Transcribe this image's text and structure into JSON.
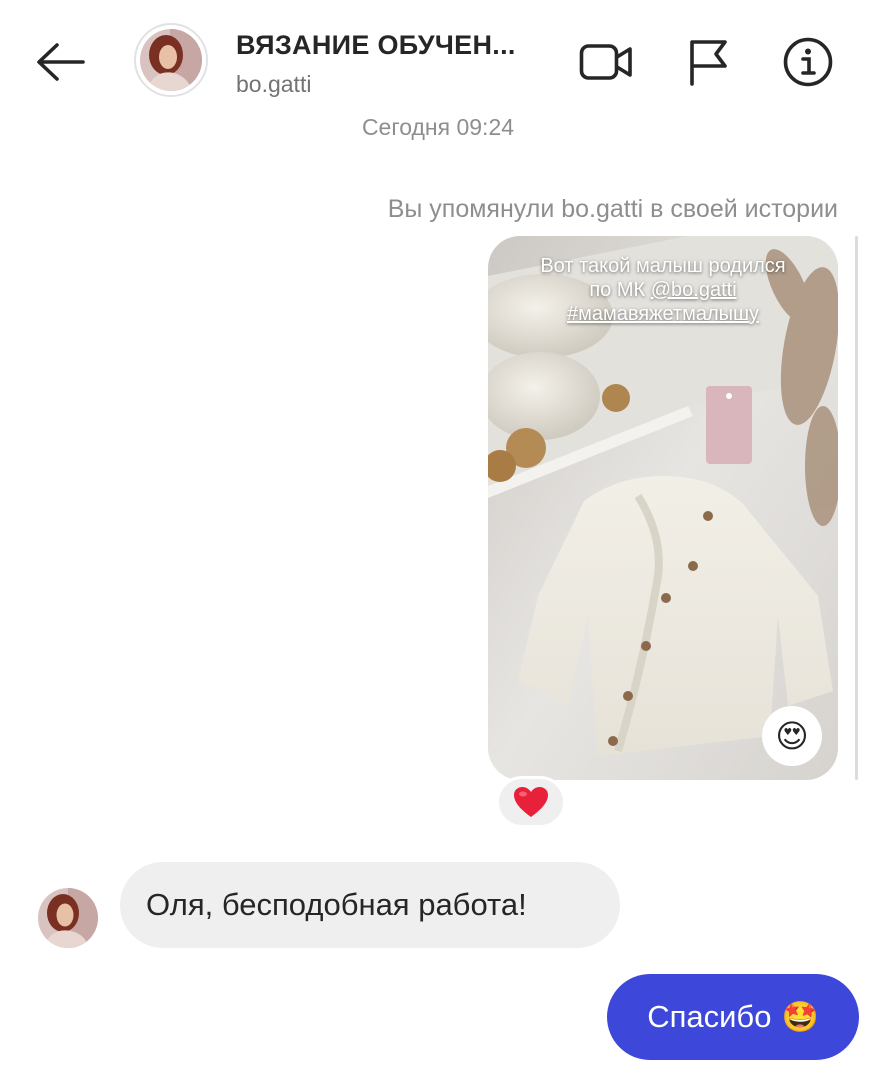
{
  "header": {
    "title": "ВЯЗАНИЕ ОБУЧЕН...",
    "username": "bo.gatti",
    "back_icon": "arrow-left-icon",
    "video_icon": "video-camera-icon",
    "flag_icon": "flag-icon",
    "info_icon": "info-icon"
  },
  "conversation": {
    "timestamp": "Сегодня 09:24",
    "mention_note": "Вы упомянули bo.gatti в своей истории",
    "story": {
      "caption_line1": "Вот такой малыш родился",
      "caption_line2_prefix": "по МК ",
      "caption_line2_mention": "@bo.gatti",
      "caption_line3": "#мамавяжетмалышу",
      "reaction_emoji": "😍"
    },
    "story_reaction": "❤️",
    "incoming_message": "Оля, бесподобная работа!",
    "outgoing_message_text": "Спасибо",
    "outgoing_message_emoji": "🤩"
  },
  "colors": {
    "accent": "#3d47d9",
    "incoming_bubble": "#efefef",
    "secondary_text": "#8e8e8e"
  }
}
